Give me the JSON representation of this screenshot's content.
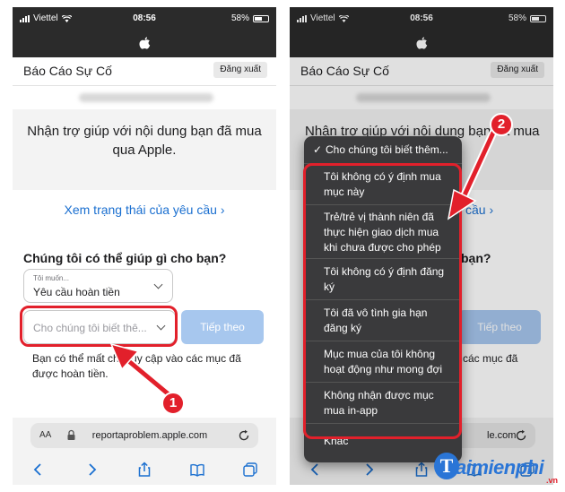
{
  "status_bar": {
    "carrier": "Viettel",
    "time": "08:56",
    "battery": "58%"
  },
  "header": {
    "title": "Báo Cáo Sự Cố",
    "logout_label": "Đăng xuất"
  },
  "hero_text": "Nhận trợ giúp với nội dung bạn đã mua qua Apple.",
  "hero_text_partial": "Nhận trợ giúp với nội dung bạn đã mua",
  "status_link": "Xem trạng thái của yêu cầu ›",
  "status_link_partial": "cầu ›",
  "help_title": "Chúng tôi có thể giúp gì cho bạn?",
  "help_title_partial": "bạn?",
  "select_want": {
    "label": "Tôi muốn...",
    "value": "Yêu cầu hoàn tiền"
  },
  "select_reason": {
    "placeholder": "Cho chúng tôi biết thê..."
  },
  "next_label": "Tiếp theo",
  "note_text": "Bạn có thể mất chỉ truy cập vào các mục đã được hoàn tiền.",
  "note_partial": "các mục đã",
  "url": "reportaproblem.apple.com",
  "url_partial": "le.com",
  "aa_label": "AA",
  "dropdown": {
    "selected": "Cho chúng tôi biết thêm...",
    "options": [
      "Tôi không có ý định mua mục này",
      "Trẻ/trẻ vị thành niên đã thực hiện giao dịch mua khi chưa được cho phép",
      "Tôi không có ý định đăng ký",
      "Tôi đã vô tình gia hạn đăng ký",
      "Mục mua của tôi không hoạt động như mong đợi",
      "Không nhận được mục mua in-app",
      "Khác"
    ]
  },
  "badges": {
    "step1": "1",
    "step2": "2"
  },
  "watermark": {
    "brand": "aimienphi",
    "logo_letter": "T",
    "domain": ".vn"
  },
  "colors": {
    "accent": "#1a6fd0",
    "highlight": "#e2202b",
    "button_disabled": "#a7c7ee"
  }
}
